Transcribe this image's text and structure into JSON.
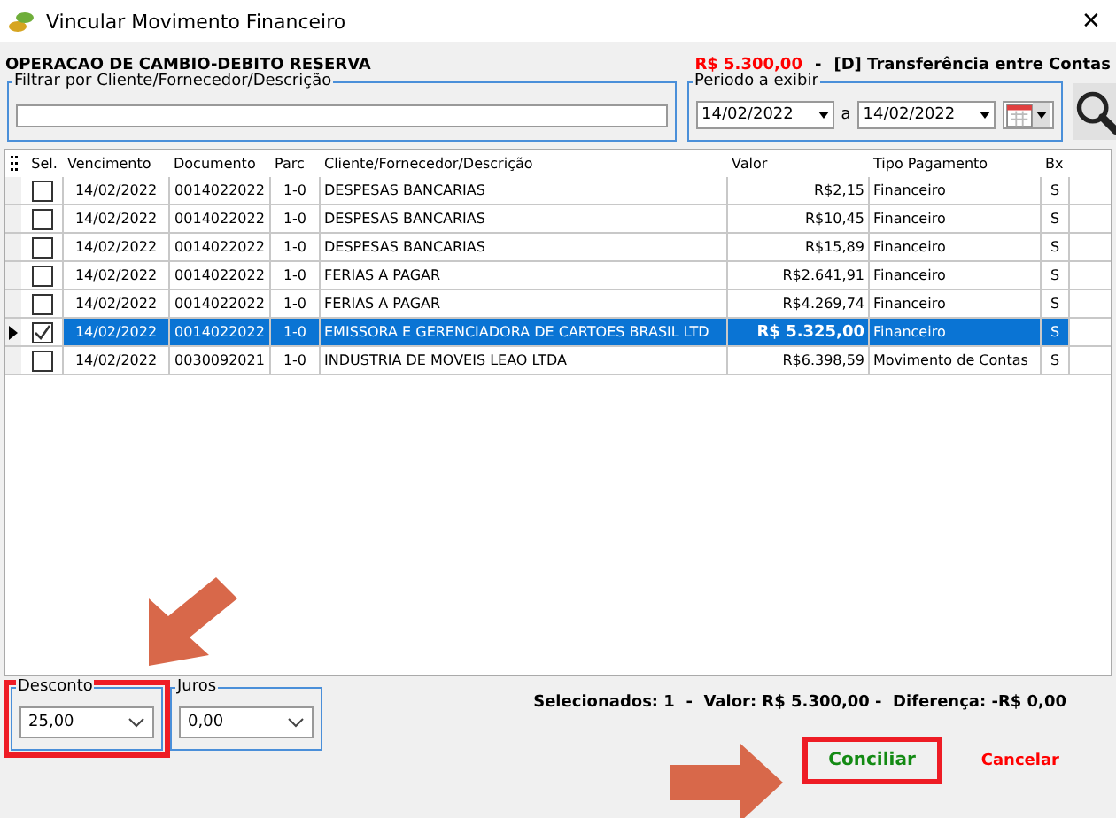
{
  "window": {
    "title": "Vincular Movimento Financeiro",
    "close": "✕"
  },
  "operation": {
    "title": "OPERACAO DE CAMBIO-DEBITO RESERVA",
    "amount": "R$ 5.300,00",
    "separator": "-",
    "type": "[D] Transferência entre Contas"
  },
  "filter": {
    "legend": "Filtrar por Cliente/Fornecedor/Descrição"
  },
  "period": {
    "legend": "Periodo a exibir",
    "from": "14/02/2022",
    "joiner": "a",
    "to": "14/02/2022"
  },
  "table": {
    "selection_column": "Sel.",
    "columns": [
      "Vencimento",
      "Documento",
      "Parc",
      "Cliente/Fornecedor/Descrição",
      "Valor",
      "Tipo Pagamento",
      "Bx"
    ],
    "rows": [
      {
        "checked": false,
        "selected": false,
        "cells": [
          "14/02/2022",
          "0014022022",
          "1-0",
          "DESPESAS BANCARIAS",
          "R$2,15",
          "Financeiro",
          "S"
        ]
      },
      {
        "checked": false,
        "selected": false,
        "cells": [
          "14/02/2022",
          "0014022022",
          "1-0",
          "DESPESAS BANCARIAS",
          "R$10,45",
          "Financeiro",
          "S"
        ]
      },
      {
        "checked": false,
        "selected": false,
        "cells": [
          "14/02/2022",
          "0014022022",
          "1-0",
          "DESPESAS BANCARIAS",
          "R$15,89",
          "Financeiro",
          "S"
        ]
      },
      {
        "checked": false,
        "selected": false,
        "cells": [
          "14/02/2022",
          "0014022022",
          "1-0",
          "FERIAS A PAGAR",
          "R$2.641,91",
          "Financeiro",
          "S"
        ]
      },
      {
        "checked": false,
        "selected": false,
        "cells": [
          "14/02/2022",
          "0014022022",
          "1-0",
          "FERIAS A PAGAR",
          "R$4.269,74",
          "Financeiro",
          "S"
        ]
      },
      {
        "checked": true,
        "selected": true,
        "cells": [
          "14/02/2022",
          "0014022022",
          "1-0",
          "EMISSORA E GERENCIADORA DE CARTOES BRASIL LTD",
          "R$ 5.325,00",
          "Financeiro",
          "S"
        ]
      },
      {
        "checked": false,
        "selected": false,
        "cells": [
          "14/02/2022",
          "0030092021",
          "1-0",
          "INDUSTRIA DE MOVEIS LEAO LTDA",
          "R$6.398,59",
          "Movimento de Contas",
          "S"
        ]
      }
    ]
  },
  "desconto": {
    "legend": "Desconto",
    "value": "25,00"
  },
  "juros": {
    "legend": "Juros",
    "value": "0,00"
  },
  "summary": "Selecionados: 1  -  Valor: R$ 5.300,00 -  Diferença: -R$ 0,00",
  "buttons": [
    {
      "label": "Conciliar",
      "kind": "confirm"
    },
    {
      "label": "Cancelar",
      "kind": "cancel"
    }
  ]
}
